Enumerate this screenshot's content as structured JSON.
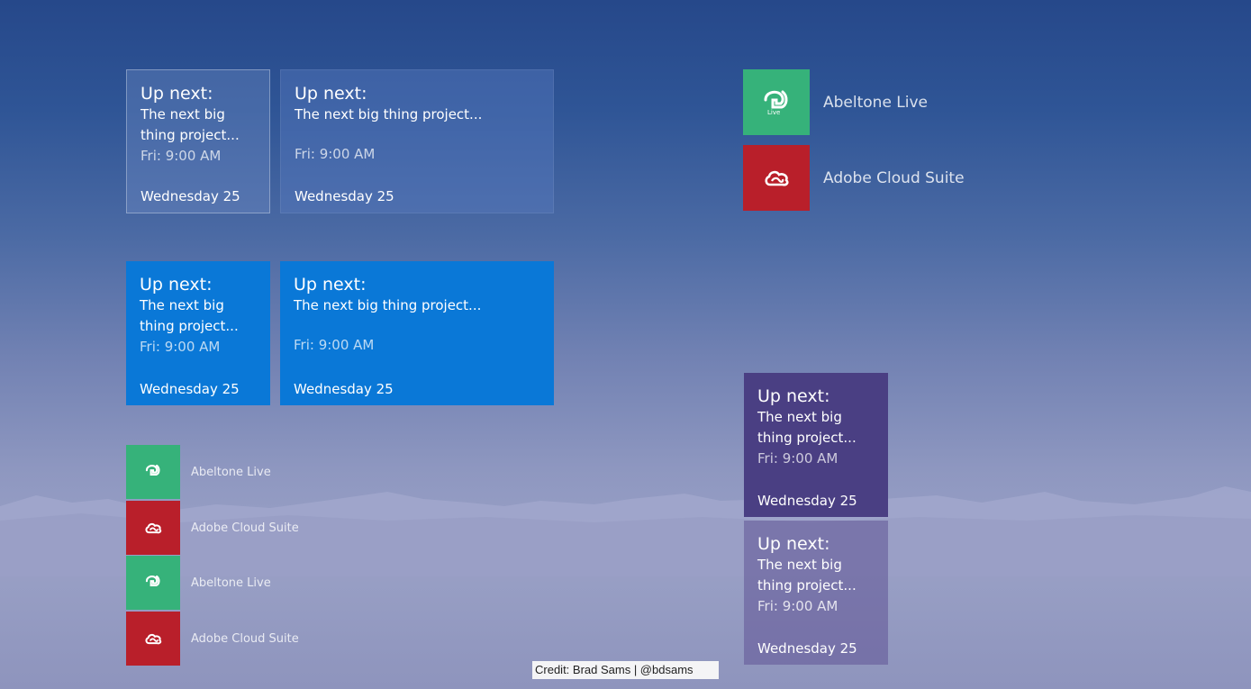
{
  "tiles": [
    {
      "head": "Up next:",
      "body1": "The next big",
      "body2": "thing project...",
      "time": "Fri: 9:00 AM",
      "day": "Wednesday 25"
    },
    {
      "head": "Up next:",
      "body1": "The next big thing project...",
      "time": "Fri: 9:00 AM",
      "day": "Wednesday 25"
    },
    {
      "head": "Up next:",
      "body1": "The next big",
      "body2": "thing project...",
      "time": "Fri: 9:00 AM",
      "day": "Wednesday 25"
    },
    {
      "head": "Up next:",
      "body1": "The next big thing project...",
      "time": "Fri: 9:00 AM",
      "day": "Wednesday 25"
    },
    {
      "head": "Up next:",
      "body1": "The next big",
      "body2": "thing project...",
      "time": "Fri: 9:00 AM",
      "day": "Wednesday 25"
    },
    {
      "head": "Up next:",
      "body1": "The next big",
      "body2": "thing project...",
      "time": "Fri: 9:00 AM",
      "day": "Wednesday 25"
    }
  ],
  "apps": {
    "ableton": "Abeltone Live",
    "adobe": "Adobe Cloud Suite",
    "ableton_icon_text": "Live"
  },
  "colors": {
    "tile_blue": "#0a78d7",
    "tile_purple": "#4a3f83",
    "ableton_green": "#36b27a",
    "adobe_red": "#b91f2a"
  },
  "icons": {
    "ableton": "ableton-live-logo",
    "adobe": "creative-cloud-logo"
  },
  "credit": "Credit: Brad Sams | @bdsams"
}
